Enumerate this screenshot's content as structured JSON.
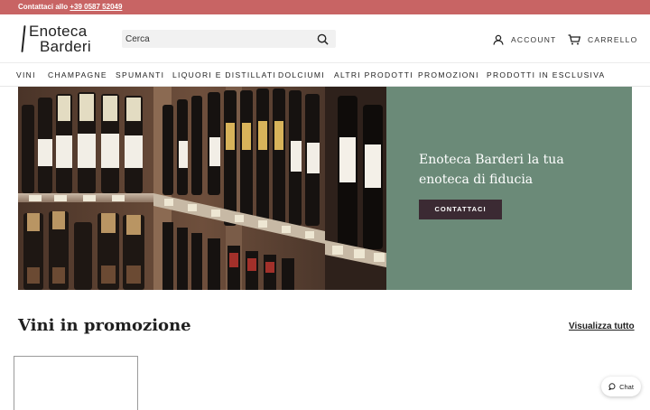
{
  "topbar": {
    "prefix": "Contattaci allo",
    "phone": "+39 0587 52049"
  },
  "logo": {
    "line1": "Enoteca",
    "line2": "Barderi"
  },
  "search": {
    "placeholder": "Cerca"
  },
  "header": {
    "account_label": "ACCOUNT",
    "cart_label": "CARRELLO"
  },
  "nav": {
    "items": [
      "VINI",
      "CHAMPAGNE",
      "SPUMANTI",
      "LIQUORI E DISTILLATI",
      "DOLCIUMI",
      "ALTRI PRODOTTI",
      "PROMOZIONI",
      "PRODOTTI IN ESCLUSIVA"
    ]
  },
  "hero": {
    "title": "Enoteca Barderi la tua enoteca di fiducia",
    "button_label": "CONTATTACI",
    "panel_color": "#6b8a78",
    "button_color": "#3b2a33"
  },
  "promo": {
    "title": "Vini in promozione",
    "view_all": "Visualizza tutto"
  },
  "chat": {
    "label": "Chat"
  },
  "colors": {
    "topbar": "#c86464",
    "text": "#1f1f1f"
  }
}
